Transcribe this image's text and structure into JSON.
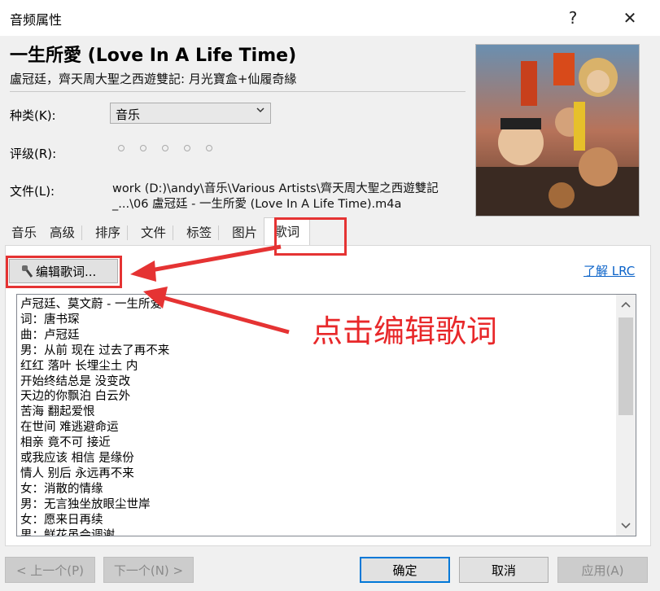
{
  "window": {
    "title": "音频属性",
    "help_glyph": "?",
    "close_glyph": "✕"
  },
  "song": {
    "title": "一生所愛 (Love In A Life Time)",
    "subtitle": "盧冠廷，齊天周大聖之西遊雙記: 月光寶盒+仙履奇緣"
  },
  "fields": {
    "genre_label": "种类(K):",
    "genre_value": "音乐",
    "rating_label": "评级(R):",
    "rating_value": 0,
    "rating_max": 5,
    "file_label": "文件(L):",
    "file_path_line1": "work (D:)\\andy\\音乐\\Various Artists\\齊天周大聖之西遊雙記",
    "file_path_line2": "_...\\06 盧冠廷 - 一生所愛 (Love In A Life Time).m4a"
  },
  "tabs": [
    {
      "label": "音乐"
    },
    {
      "label": "高级"
    },
    {
      "label": "排序"
    },
    {
      "label": "文件"
    },
    {
      "label": "标签"
    },
    {
      "label": "图片"
    },
    {
      "label": "歌词",
      "active": true
    }
  ],
  "lyrics": {
    "edit_button": "编辑歌词...",
    "learn_link": "了解 LRC",
    "lines": [
      "卢冠廷、莫文蔚 - 一生所爱",
      "词：唐书琛",
      "曲：卢冠廷",
      "男：从前 现在 过去了再不来",
      "红红 落叶 长埋尘土 内",
      "开始终结总是 没变改",
      "天边的你飘泊 白云外",
      "苦海 翻起爱恨",
      "在世间 难逃避命运",
      "相亲 竟不可 接近",
      "或我应该 相信 是缘份",
      "情人 别后 永远再不来",
      "女：消散的情缘",
      "男：无言独坐放眼尘世岸",
      "女：愿来日再续",
      "男：鲜花虽会调谢"
    ]
  },
  "buttons": {
    "prev": "< 上一个(P)",
    "next": "下一个(N) >",
    "ok": "确定",
    "cancel": "取消",
    "apply": "应用(A)"
  },
  "annotation": {
    "text": "点击编辑歌词",
    "color": "#e8282a"
  },
  "colors": {
    "accent": "#0078d7",
    "link": "#0b63c9",
    "annotation_red": "#e53333"
  }
}
